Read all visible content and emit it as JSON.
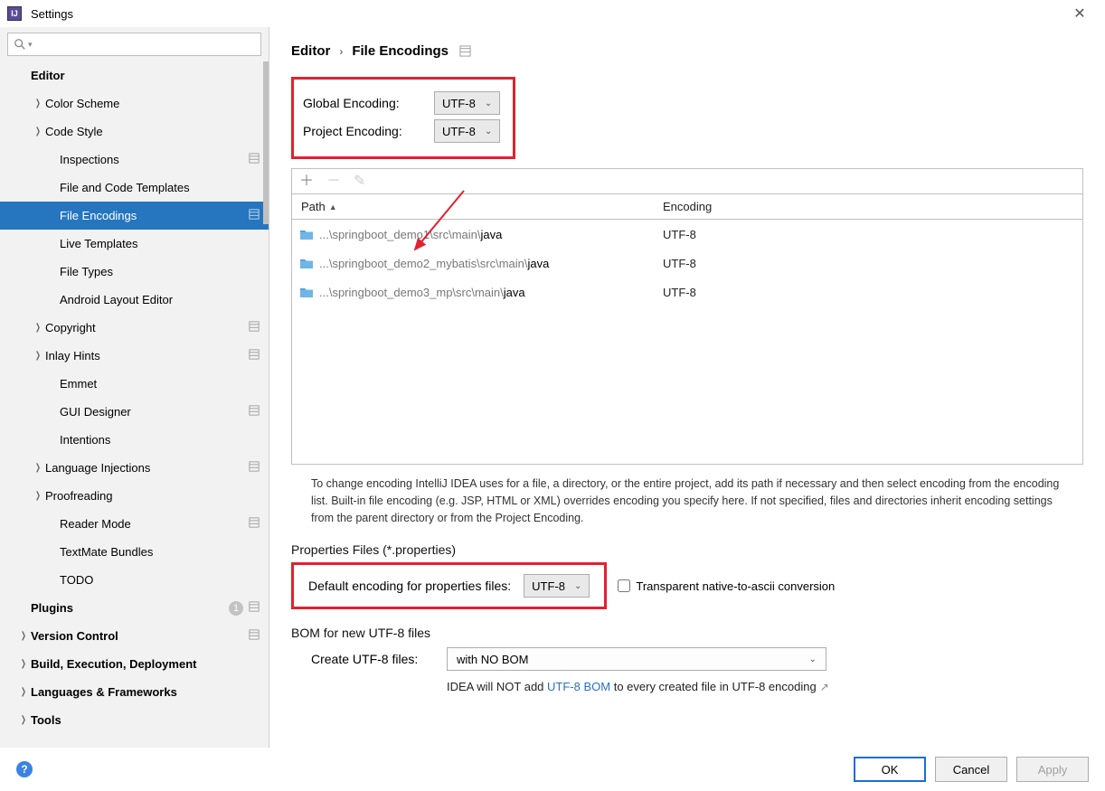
{
  "window": {
    "title": "Settings"
  },
  "breadcrumb": {
    "parent": "Editor",
    "current": "File Encodings"
  },
  "sidebar": {
    "items": [
      {
        "label": "Editor",
        "bold": true,
        "indent": 1,
        "arrow": false,
        "icon": false
      },
      {
        "label": "Color Scheme",
        "indent": 2,
        "arrow": true
      },
      {
        "label": "Code Style",
        "indent": 2,
        "arrow": true
      },
      {
        "label": "Inspections",
        "indent": 3,
        "icon": true
      },
      {
        "label": "File and Code Templates",
        "indent": 3
      },
      {
        "label": "File Encodings",
        "indent": 3,
        "icon": true,
        "selected": true
      },
      {
        "label": "Live Templates",
        "indent": 3
      },
      {
        "label": "File Types",
        "indent": 3
      },
      {
        "label": "Android Layout Editor",
        "indent": 3
      },
      {
        "label": "Copyright",
        "indent": 2,
        "arrow": true,
        "icon": true
      },
      {
        "label": "Inlay Hints",
        "indent": 2,
        "arrow": true,
        "icon": true
      },
      {
        "label": "Emmet",
        "indent": 3
      },
      {
        "label": "GUI Designer",
        "indent": 3,
        "icon": true
      },
      {
        "label": "Intentions",
        "indent": 3
      },
      {
        "label": "Language Injections",
        "indent": 2,
        "arrow": true,
        "icon": true
      },
      {
        "label": "Proofreading",
        "indent": 2,
        "arrow": true
      },
      {
        "label": "Reader Mode",
        "indent": 3,
        "icon": true
      },
      {
        "label": "TextMate Bundles",
        "indent": 3
      },
      {
        "label": "TODO",
        "indent": 3
      },
      {
        "label": "Plugins",
        "bold": true,
        "indent": 1,
        "icon": true,
        "badge": "1"
      },
      {
        "label": "Version Control",
        "bold": true,
        "indent": 1,
        "arrow": true,
        "icon": true
      },
      {
        "label": "Build, Execution, Deployment",
        "bold": true,
        "indent": 1,
        "arrow": true
      },
      {
        "label": "Languages & Frameworks",
        "bold": true,
        "indent": 1,
        "arrow": true
      },
      {
        "label": "Tools",
        "bold": true,
        "indent": 1,
        "arrow": true
      }
    ]
  },
  "encoding": {
    "global_label": "Global Encoding:",
    "global_value": "UTF-8",
    "project_label": "Project Encoding:",
    "project_value": "UTF-8"
  },
  "table": {
    "col_path": "Path",
    "col_enc": "Encoding",
    "rows": [
      {
        "prefix": "...\\springboot_demo1\\src\\main\\",
        "end": "java",
        "enc": "UTF-8"
      },
      {
        "prefix": "...\\springboot_demo2_mybatis\\src\\main\\",
        "end": "java",
        "enc": "UTF-8"
      },
      {
        "prefix": "...\\springboot_demo3_mp\\src\\main\\",
        "end": "java",
        "enc": "UTF-8"
      }
    ]
  },
  "help_text": "To change encoding IntelliJ IDEA uses for a file, a directory, or the entire project, add its path if necessary and then select encoding from the encoding list. Built-in file encoding (e.g. JSP, HTML or XML) overrides encoding you specify here. If not specified, files and directories inherit encoding settings from the parent directory or from the Project Encoding.",
  "properties": {
    "section": "Properties Files (*.properties)",
    "label": "Default encoding for properties files:",
    "value": "UTF-8",
    "checkbox": "Transparent native-to-ascii conversion"
  },
  "bom": {
    "section": "BOM for new UTF-8 files",
    "label": "Create UTF-8 files:",
    "value": "with NO BOM",
    "hint_pre": "IDEA will NOT add ",
    "hint_link": "UTF-8 BOM",
    "hint_post": " to every created file in UTF-8 encoding"
  },
  "buttons": {
    "ok": "OK",
    "cancel": "Cancel",
    "apply": "Apply"
  }
}
